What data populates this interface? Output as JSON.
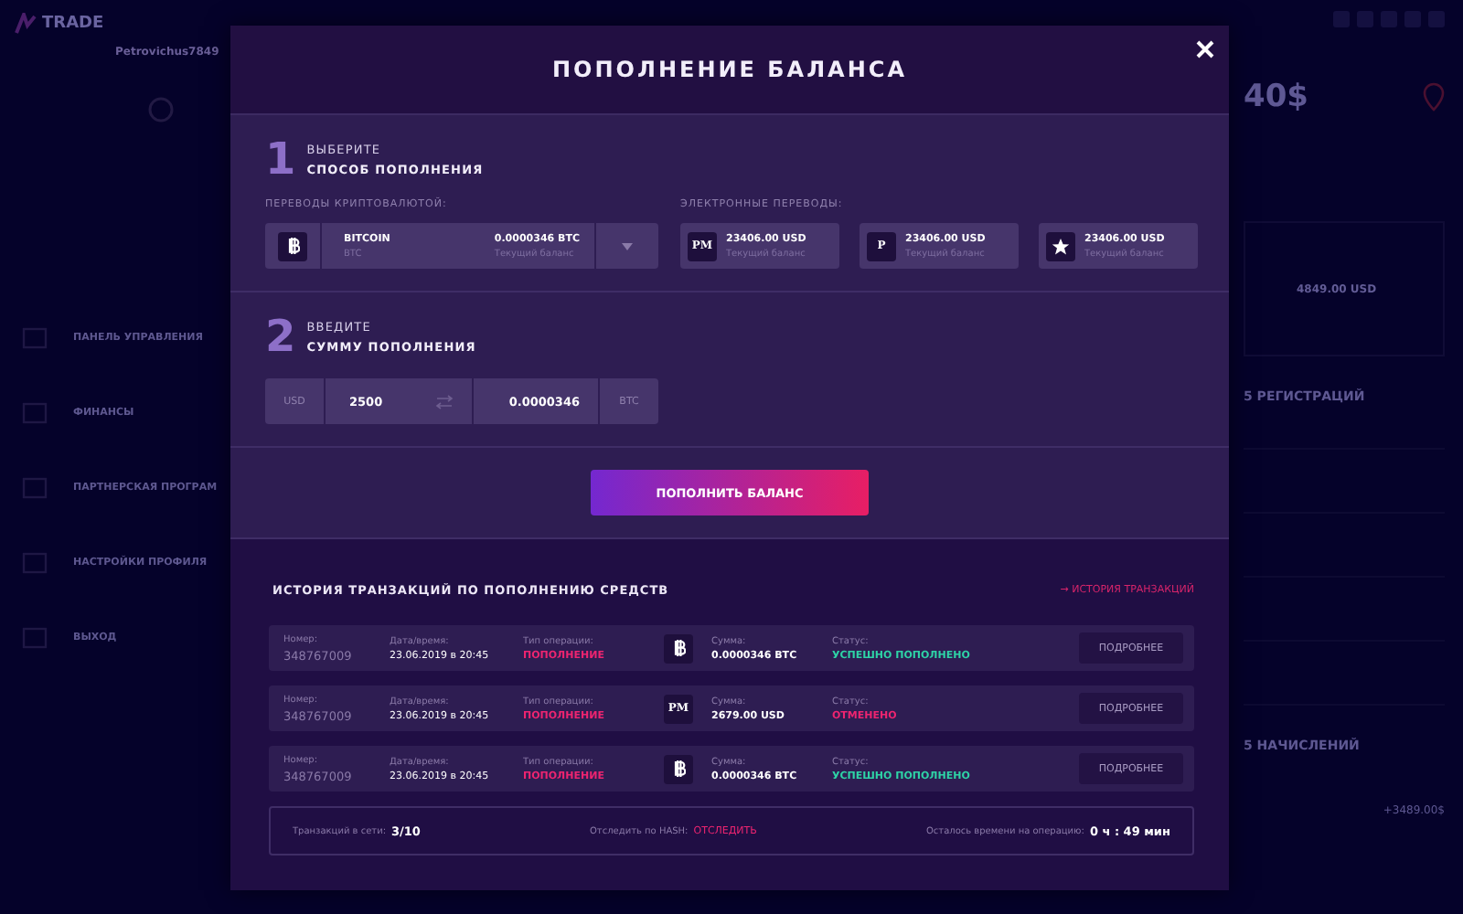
{
  "background": {
    "logo": "TRADE",
    "username": "Petrovichus7849",
    "nav": [
      {
        "label": "ПАНЕЛЬ УПРАВЛЕНИЯ"
      },
      {
        "label": "ФИНАНСЫ"
      },
      {
        "label": "ПАРТНЕРСКАЯ ПРОГРАМ"
      },
      {
        "label": "НАСТРОЙКИ ПРОФИЛЯ"
      },
      {
        "label": "ВЫХОД"
      }
    ],
    "balance": "40$",
    "wallet_amount": "4849.00 USD",
    "registrations_title": "5 РЕГИСТРАЦИЙ",
    "accruals_title": "5 НАЧИСЛЕНИЙ",
    "accrual_amount": "+3489.00$"
  },
  "modal": {
    "title": "ПОПОЛНЕНИЕ БАЛАНСА",
    "step1": {
      "number": "1",
      "line1": "ВЫБЕРИТЕ",
      "line2": "СПОСОБ ПОПОЛНЕНИЯ"
    },
    "crypto": {
      "label": "ПЕРЕВОДЫ КРИПТОВАЛЮТОЙ:",
      "kind": "bitcoin",
      "name": "BITCOIN",
      "code": "BTC",
      "amount": "0.0000346 BTC",
      "caption": "Текущий баланс"
    },
    "ewallets": {
      "label": "ЭЛЕКТРОННЫЕ ПЕРЕВОДЫ:",
      "items": [
        {
          "kind": "text",
          "logo": "PM",
          "amount": "23406.00 USD",
          "caption": "Текущий баланс"
        },
        {
          "kind": "text",
          "logo": "P",
          "amount": "23406.00 USD",
          "caption": "Текущий баланс"
        },
        {
          "kind": "star",
          "amount": "23406.00 USD",
          "caption": "Текущий баланс"
        }
      ]
    },
    "step2": {
      "number": "2",
      "line1": "ВВЕДИТЕ",
      "line2": "СУММУ ПОПОЛНЕНИЯ"
    },
    "amount": {
      "from_currency": "USD",
      "from_value": "2500",
      "to_value": "0.0000346",
      "to_currency": "BTC"
    },
    "submit": "ПОПОЛНИТЬ БАЛАНС",
    "history": {
      "title": "ИСТОРИЯ ТРАНЗАКЦИЙ ПО ПОПОЛНЕНИЮ СРЕДСТВ",
      "link": "→ ИСТОРИЯ ТРАНЗАКЦИЙ",
      "rows": [
        {
          "number_label": "Номер:",
          "number": "348767009",
          "date_label": "Дата/время:",
          "date": "23.06.2019 в 20:45",
          "type_label": "Тип операции:",
          "type": "ПОПОЛНЕНИЕ",
          "icon": {
            "kind": "bitcoin"
          },
          "amount_label": "Сумма:",
          "amount": "0.0000346 BTC",
          "status_label": "Статус:",
          "status": {
            "kind": "success",
            "text": "УСПЕШНО ПОПОЛНЕНО"
          },
          "details": "ПОДРОБНЕЕ"
        },
        {
          "number_label": "Номер:",
          "number": "348767009",
          "date_label": "Дата/время:",
          "date": "23.06.2019 в 20:45",
          "type_label": "Тип операции:",
          "type": "ПОПОЛНЕНИЕ",
          "icon": {
            "kind": "text",
            "text": "PM"
          },
          "amount_label": "Сумма:",
          "amount": "2679.00 USD",
          "status_label": "Статус:",
          "status": {
            "kind": "cancelled",
            "text": "ОТМЕНЕНО"
          },
          "details": "ПОДРОБНЕЕ"
        },
        {
          "number_label": "Номер:",
          "number": "348767009",
          "date_label": "Дата/время:",
          "date": "23.06.2019 в 20:45",
          "type_label": "Тип операции:",
          "type": "ПОПОЛНЕНИЕ",
          "icon": {
            "kind": "bitcoin"
          },
          "amount_label": "Сумма:",
          "amount": "0.0000346 BTC",
          "status_label": "Статус:",
          "status": {
            "kind": "success",
            "text": "УСПЕШНО ПОПОЛНЕНО"
          },
          "details": "ПОДРОБНЕЕ"
        }
      ],
      "footer": {
        "in_network_label": "Транзакций в сети:",
        "in_network": "3/10",
        "hash_label": "Отследить по HASH:",
        "hash_link": "ОТСЛЕДИТЬ",
        "time_label": "Осталось времени на операцию:",
        "time": "0 ч : 49 мин"
      }
    }
  }
}
